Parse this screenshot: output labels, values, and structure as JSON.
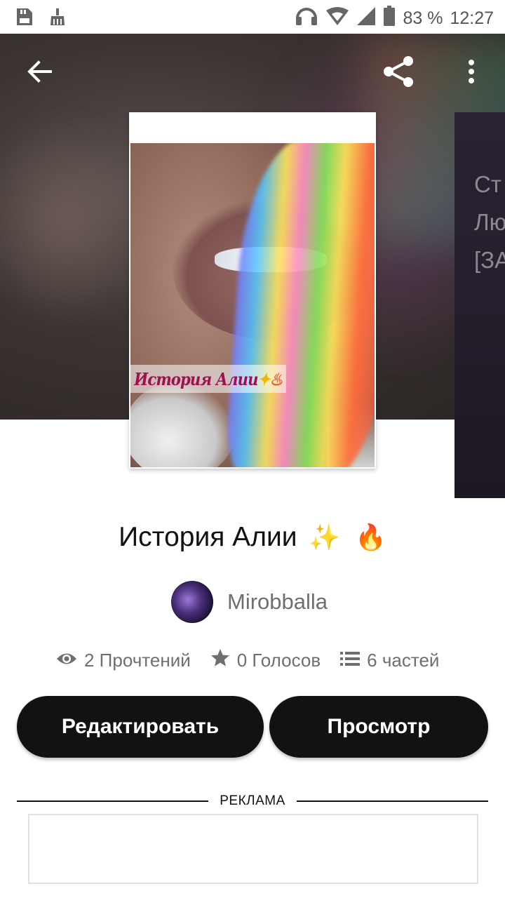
{
  "status_bar": {
    "battery_text": "83 %",
    "time": "12:27",
    "left_icons": [
      "sd-card-icon",
      "broom-icon"
    ],
    "right_icons": [
      "headset-icon",
      "wifi-icon",
      "signal-icon",
      "battery-icon"
    ]
  },
  "toolbar": {
    "back_icon": "arrow-back-icon",
    "share_icon": "share-icon",
    "more_icon": "more-vert-icon"
  },
  "story": {
    "title": "История Алии",
    "title_emojis": [
      "✨",
      "🔥"
    ],
    "cover_caption": "История Алии",
    "author": "Mirobballa",
    "reads": "2 Прочтений",
    "votes": "0 Голосов",
    "parts": "6 частей"
  },
  "next_cover": {
    "lines": [
      "Ст",
      "Лю",
      "[ЗА"
    ]
  },
  "actions": {
    "edit_label": "Редактировать",
    "view_label": "Просмотр"
  },
  "ad": {
    "label": "РЕКЛАМА"
  },
  "colors": {
    "button_bg": "#121212",
    "button_text": "#ffffff",
    "meta_text": "#6f6f6f"
  }
}
